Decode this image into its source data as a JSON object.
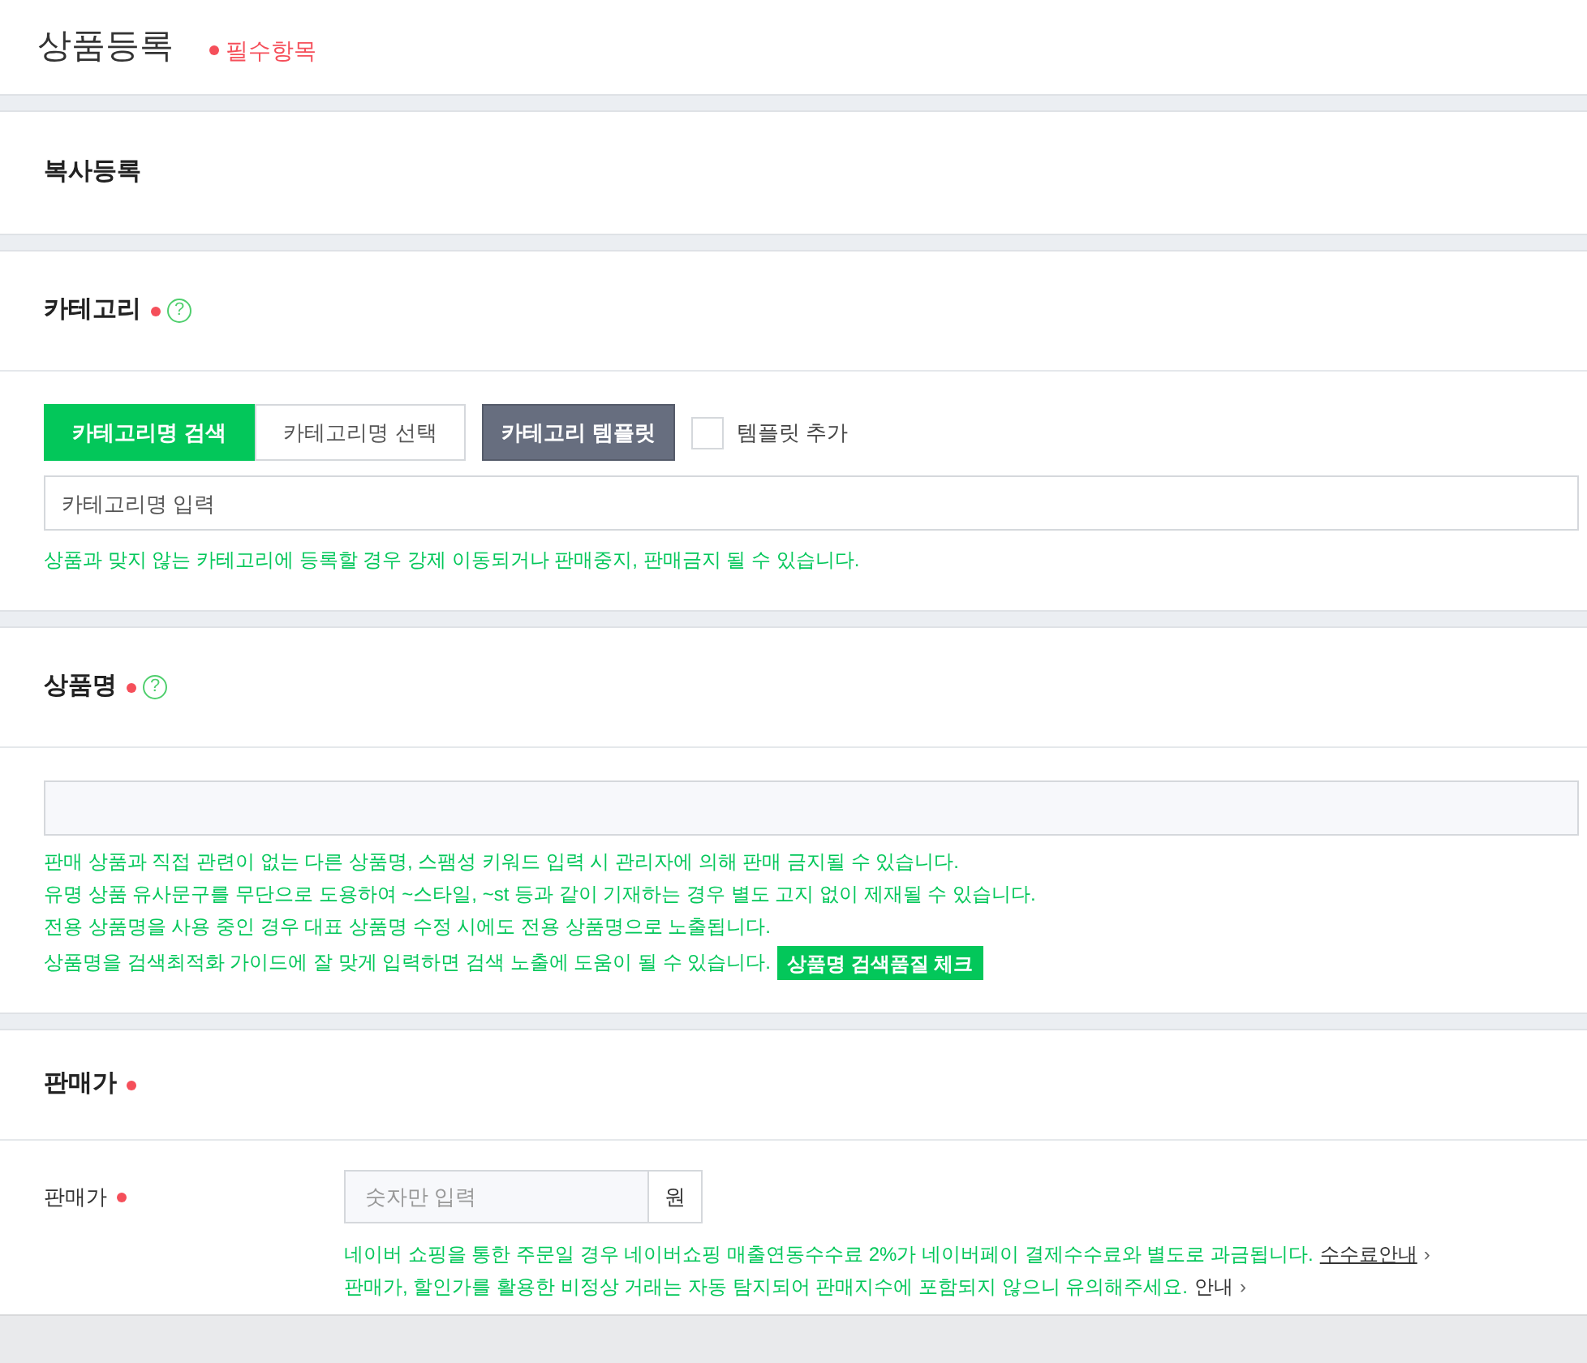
{
  "page_title": "상품등록",
  "required_legend": "필수항목",
  "copy_section": {
    "title": "복사등록"
  },
  "category": {
    "title": "카테고리",
    "required": true,
    "help": "?",
    "tabs": [
      {
        "label": "카테고리명 검색",
        "selected": true
      },
      {
        "label": "카테고리명 선택",
        "selected": false
      }
    ],
    "template_button": "카테고리 템플릿",
    "template_add": {
      "label": "템플릿 추가",
      "checked": false
    },
    "search": {
      "placeholder": "카테고리명 입력"
    },
    "notice": "상품과 맞지 않는 카테고리에 등록할 경우 강제 이동되거나 판매중지, 판매금지 될 수 있습니다."
  },
  "product_name": {
    "title": "상품명",
    "required": true,
    "help": "?",
    "notices": [
      "판매 상품과 직접 관련이 없는 다른 상품명, 스팸성 키워드 입력 시 관리자에 의해 판매 금지될 수 있습니다.",
      "유명 상품 유사문구를 무단으로 도용하여 ~스타일, ~st 등과 같이 기재하는 경우 별도 고지 없이 제재될 수 있습니다.",
      "전용 상품명을 사용 중인 경우 대표 상품명 수정 시에도 전용 상품명으로 노출됩니다.",
      "상품명을 검색최적화 가이드에 잘 맞게 입력하면 검색 노출에 도움이 될 수 있습니다."
    ],
    "check_button": "상품명 검색품질 체크"
  },
  "price": {
    "title": "판매가",
    "required": true,
    "field_label": "판매가",
    "placeholder": "숫자만 입력",
    "unit": "원",
    "notice": "네이버 쇼핑을 통한 주문일 경우 네이버쇼핑 매출연동수수료 2%가 네이버페이 결제수수료와 별도로 과금됩니다.",
    "notice_link": "수수료안내",
    "link_arrow": "›",
    "notice2": "판매가, 할인가를 활용한 비정상 거래는 자동 탐지되어 판매지수에 포함되지 않으니 유의해주세요.",
    "notice2_link": "안내",
    "notice2_arrow": "›"
  }
}
